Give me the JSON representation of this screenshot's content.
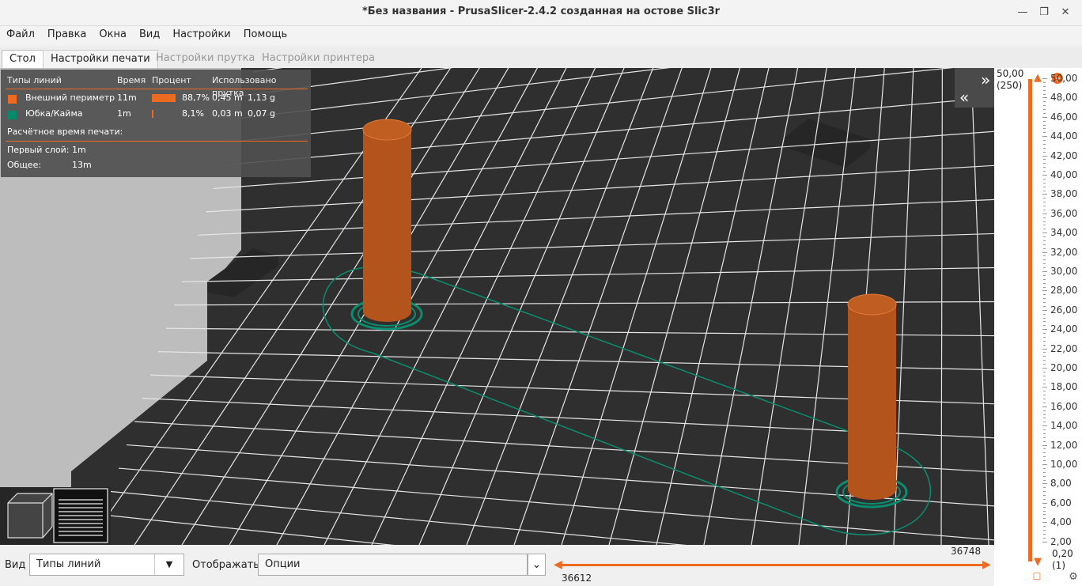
{
  "window": {
    "title": "*Без названия - PrusaSlicer-2.4.2 созданная на остове Slic3r",
    "minimize_icon": "minimize-icon",
    "maximize_icon": "maximize-icon",
    "close_icon": "close-icon"
  },
  "menu": [
    "Файл",
    "Правка",
    "Окна",
    "Вид",
    "Настройки",
    "Помощь"
  ],
  "tabs": [
    {
      "label": "Стол",
      "state": "active"
    },
    {
      "label": "Настройки печати",
      "state": "normal"
    },
    {
      "label": "Настройки прутка",
      "state": "disabled"
    },
    {
      "label": "Настройки принтера",
      "state": "disabled"
    }
  ],
  "legend": {
    "headers": {
      "type": "Типы линий",
      "time": "Время",
      "percent": "Процент",
      "used": "Использовано прутка"
    },
    "rows": [
      {
        "name": "Внешний периметр",
        "time": "11m",
        "percent": "88,7%",
        "percent_value": 0.887,
        "length": "0,45 m",
        "weight": "1,13 g",
        "color": "#ed6b21"
      },
      {
        "name": "Юбка/Кайма",
        "time": "1m",
        "percent": "8,1%",
        "percent_value": 0.081,
        "length": "0,03 m",
        "weight": "0,07 g",
        "color": "#008c6a"
      }
    ],
    "estimated_title": "Расчётное время печати:",
    "first_layer_label": "Первый слой:",
    "first_layer_value": "1m",
    "total_label": "Общее:",
    "total_value": "13m"
  },
  "layer_slider": {
    "top_value": "50,00",
    "top_layer": "(250)",
    "bottom_value": "0,20",
    "bottom_layer": "(1)",
    "ticks": [
      "50,00",
      "48,00",
      "46,00",
      "44,00",
      "42,00",
      "40,00",
      "38,00",
      "36,00",
      "34,00",
      "32,00",
      "30,00",
      "28,00",
      "26,00",
      "24,00",
      "22,00",
      "20,00",
      "18,00",
      "16,00",
      "14,00",
      "12,00",
      "10,00",
      "8,00",
      "6,00",
      "4,00",
      "2,00"
    ]
  },
  "move_slider": {
    "right_value": "36748",
    "left_value": "36612"
  },
  "bottom": {
    "view_label": "Вид",
    "view_value": "Типы линий",
    "show_label": "Отображать",
    "show_value": "Опции"
  },
  "colors": {
    "accent": "#ed6b21",
    "skirt": "#008c6a",
    "bed": "#333333"
  }
}
